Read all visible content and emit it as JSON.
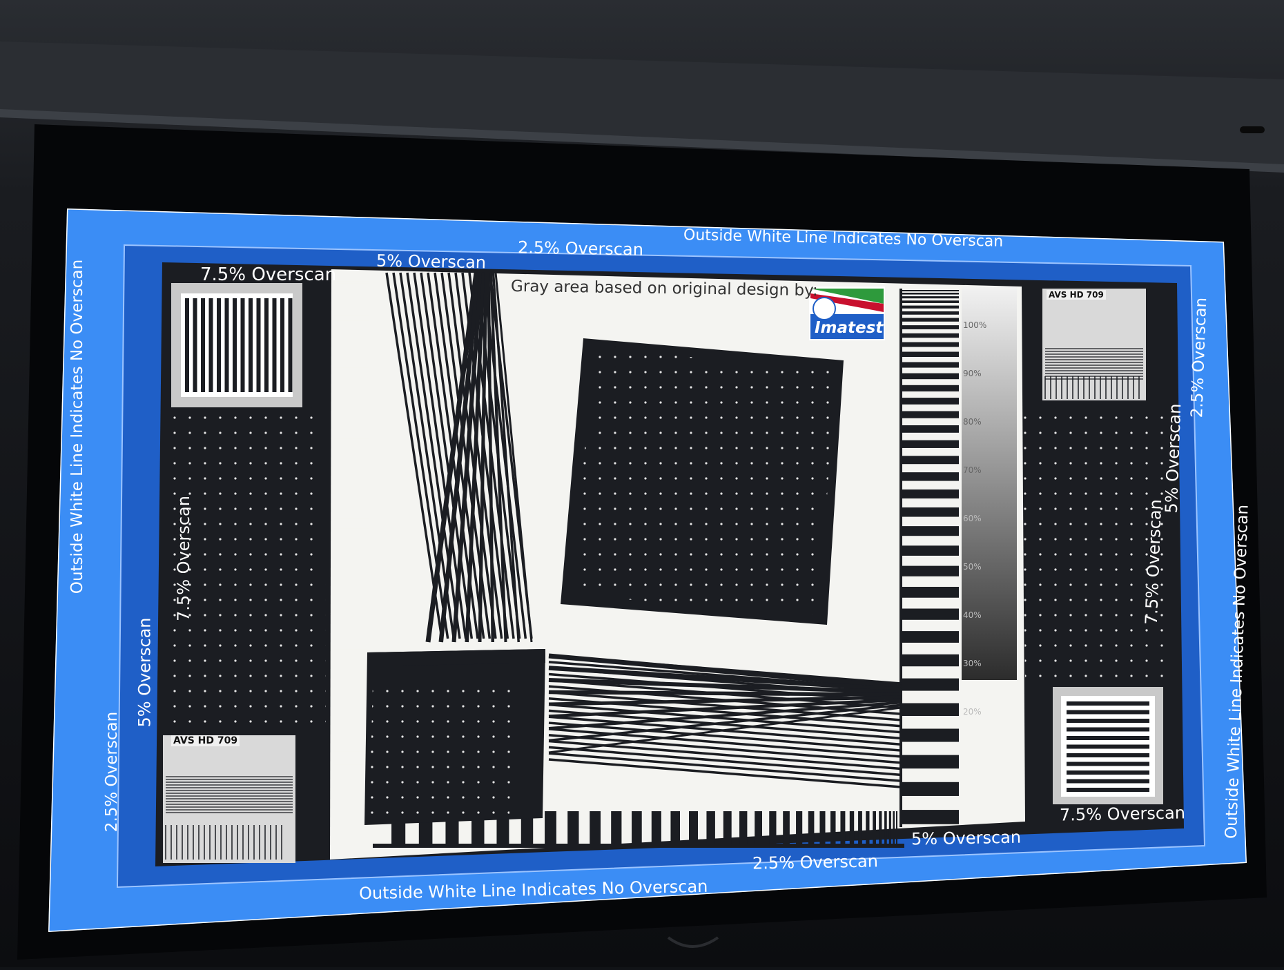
{
  "pattern": {
    "attribution": "Gray area based on original design by:",
    "logo_text": "Imatest",
    "no_overscan_label": "Outside White Line Indicates No Overscan",
    "overscan_2_5": "2.5% Overscan",
    "overscan_5": "5% Overscan",
    "overscan_7_5": "7.5% Overscan",
    "badge_text": "AVS HD 709",
    "gray_steps": [
      "100%",
      "90%",
      "80%",
      "70%",
      "60%",
      "50%",
      "40%",
      "30%",
      "20%"
    ]
  },
  "colors": {
    "room_dark": "#111317",
    "screen_blue_outer": "#3b8df5",
    "screen_blue_inner": "#1f5fc7",
    "pattern_black": "#1b1d22",
    "pattern_white": "#f4f4f1",
    "logo_blue": "#1f5fc7",
    "logo_red": "#c8102e",
    "logo_green": "#2e9a3c"
  }
}
